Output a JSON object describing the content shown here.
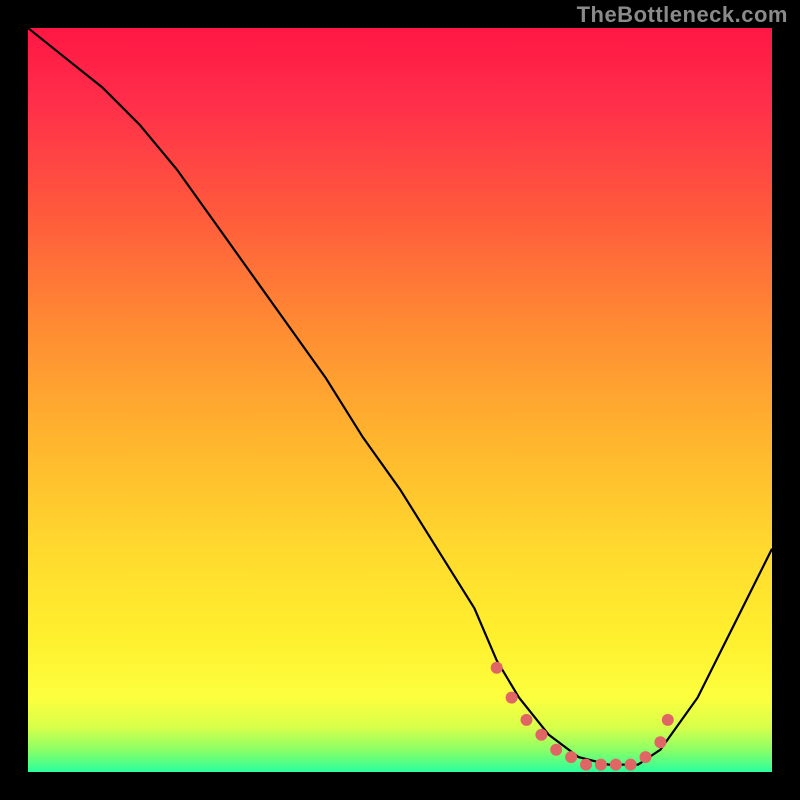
{
  "watermark": "TheBottleneck.com",
  "chart_data": {
    "type": "line",
    "title": "",
    "xlabel": "",
    "ylabel": "",
    "xlim": [
      0,
      100
    ],
    "ylim": [
      0,
      100
    ],
    "series": [
      {
        "name": "bottleneck-curve",
        "x": [
          0,
          5,
          10,
          15,
          20,
          25,
          30,
          35,
          40,
          45,
          50,
          55,
          60,
          63,
          66,
          70,
          74,
          78,
          82,
          85,
          90,
          95,
          100
        ],
        "y": [
          100,
          96,
          92,
          87,
          81,
          74,
          67,
          60,
          53,
          45,
          38,
          30,
          22,
          15,
          10,
          5,
          2,
          1,
          1,
          3,
          10,
          20,
          30
        ]
      },
      {
        "name": "optimal-zone",
        "x": [
          63,
          65,
          67,
          69,
          71,
          73,
          75,
          77,
          79,
          81,
          83,
          85,
          86
        ],
        "y": [
          14,
          10,
          7,
          5,
          3,
          2,
          1,
          1,
          1,
          1,
          2,
          4,
          7
        ]
      }
    ],
    "gradient_stops": [
      {
        "offset": 0.0,
        "color": "#ff1744"
      },
      {
        "offset": 0.1,
        "color": "#ff2e4a"
      },
      {
        "offset": 0.25,
        "color": "#ff5a3c"
      },
      {
        "offset": 0.4,
        "color": "#ff8b33"
      },
      {
        "offset": 0.55,
        "color": "#ffb42e"
      },
      {
        "offset": 0.7,
        "color": "#ffd92e"
      },
      {
        "offset": 0.82,
        "color": "#fff02e"
      },
      {
        "offset": 0.9,
        "color": "#fcff3e"
      },
      {
        "offset": 0.94,
        "color": "#d8ff4a"
      },
      {
        "offset": 0.97,
        "color": "#8cff66"
      },
      {
        "offset": 1.0,
        "color": "#2bff9e"
      }
    ],
    "curve_stroke": "#000000",
    "marker_color": "#e06666",
    "marker_radius": 6
  }
}
